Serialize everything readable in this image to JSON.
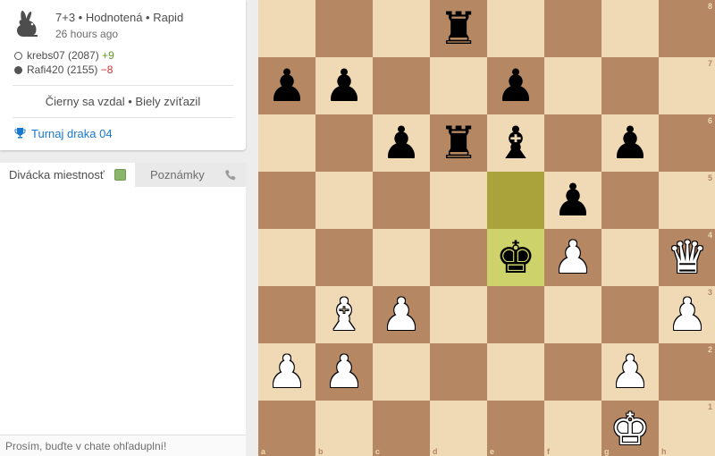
{
  "game": {
    "mode": "7+3 • Hodnotená • Rapid",
    "time": "26 hours ago",
    "white": {
      "name": "krebs07 (2087)",
      "diff": "+9"
    },
    "black": {
      "name": "Rafi420 (2155)",
      "diff": "−8"
    },
    "result": "Čierny sa vzdal • Biely zvíťazil",
    "tournament": "Turnaj draka 04",
    "icons": {
      "speed": "rabbit-icon",
      "tournament": "trophy-icon"
    }
  },
  "chat": {
    "tab_spectator": "Divácka miestnosť",
    "tab_notes": "Poznámky",
    "placeholder": "Prosím, buďte v chate ohľaduplní!",
    "icons": {
      "toggle": "chat-toggle-checkbox",
      "voice": "phone-icon"
    }
  },
  "board": {
    "files": [
      "a",
      "b",
      "c",
      "d",
      "e",
      "f",
      "g",
      "h"
    ],
    "ranks": [
      "8",
      "7",
      "6",
      "5",
      "4",
      "3",
      "2",
      "1"
    ],
    "highlight_last_move": {
      "from": "e5",
      "to": "e4"
    },
    "colors": {
      "light": "#f0d9b5",
      "dark": "#b58863",
      "from": "#aaa23a",
      "to": "#cdd26a"
    },
    "pieces": [
      {
        "square": "d8",
        "piece": "rook",
        "color": "black"
      },
      {
        "square": "a7",
        "piece": "pawn",
        "color": "black"
      },
      {
        "square": "b7",
        "piece": "pawn",
        "color": "black"
      },
      {
        "square": "e7",
        "piece": "pawn",
        "color": "black"
      },
      {
        "square": "c6",
        "piece": "pawn",
        "color": "black"
      },
      {
        "square": "d6",
        "piece": "rook",
        "color": "black"
      },
      {
        "square": "e6",
        "piece": "bishop",
        "color": "black"
      },
      {
        "square": "g6",
        "piece": "pawn",
        "color": "black"
      },
      {
        "square": "f5",
        "piece": "pawn",
        "color": "black"
      },
      {
        "square": "e4",
        "piece": "king",
        "color": "black"
      },
      {
        "square": "f4",
        "piece": "pawn",
        "color": "white"
      },
      {
        "square": "h4",
        "piece": "queen",
        "color": "white"
      },
      {
        "square": "b3",
        "piece": "bishop",
        "color": "white"
      },
      {
        "square": "c3",
        "piece": "pawn",
        "color": "white"
      },
      {
        "square": "h3",
        "piece": "pawn",
        "color": "white"
      },
      {
        "square": "a2",
        "piece": "pawn",
        "color": "white"
      },
      {
        "square": "b2",
        "piece": "pawn",
        "color": "white"
      },
      {
        "square": "g2",
        "piece": "pawn",
        "color": "white"
      },
      {
        "square": "g1",
        "piece": "king",
        "color": "white"
      }
    ]
  }
}
